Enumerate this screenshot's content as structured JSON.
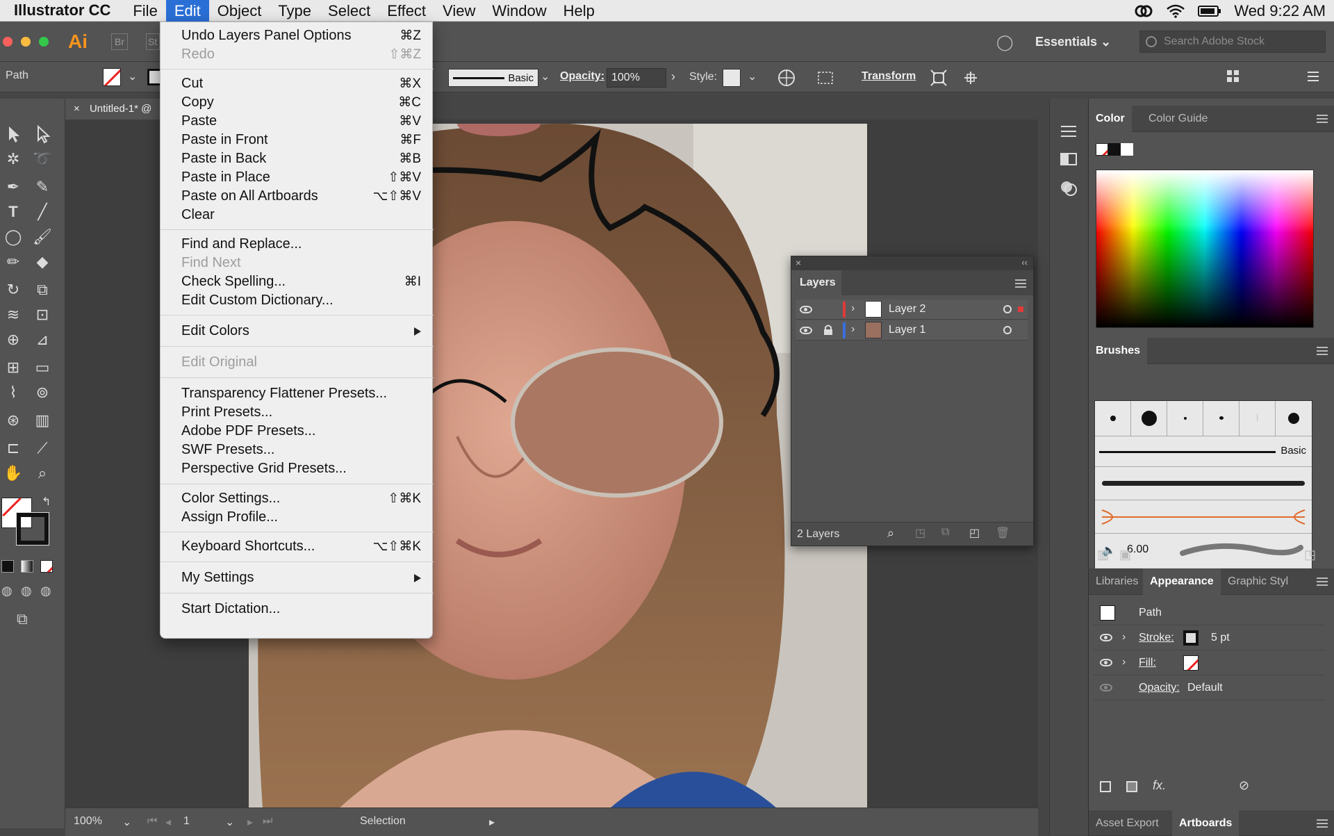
{
  "menubar": {
    "app_name": "Illustrator CC",
    "items": [
      "File",
      "Edit",
      "Object",
      "Type",
      "Select",
      "Effect",
      "View",
      "Window",
      "Help"
    ],
    "clock": "Wed 9:22 AM"
  },
  "appbar": {
    "logo": "Ai",
    "bridge": "Br",
    "stock": "St",
    "workspace": "Essentials",
    "search_placeholder": "Search Adobe Stock"
  },
  "control_bar": {
    "selection_type": "Path",
    "brush_name": "Basic",
    "opacity_label": "Opacity:",
    "opacity_value": "100%",
    "style_label": "Style:",
    "transform_label": "Transform"
  },
  "document": {
    "tab_title": "Untitled-1* @",
    "tab_close": "×"
  },
  "status_bar": {
    "zoom": "100%",
    "artboard_number": "1",
    "tool_name": "Selection"
  },
  "edit_menu": {
    "items": [
      {
        "label": "Undo Layers Panel Options",
        "shortcut": "⌘Z",
        "disabled": false
      },
      {
        "label": "Redo",
        "shortcut": "⇧⌘Z",
        "disabled": true
      },
      {
        "label": "Cut",
        "shortcut": "⌘X",
        "disabled": false
      },
      {
        "label": "Copy",
        "shortcut": "⌘C",
        "disabled": false
      },
      {
        "label": "Paste",
        "shortcut": "⌘V",
        "disabled": false
      },
      {
        "label": "Paste in Front",
        "shortcut": "⌘F",
        "disabled": false
      },
      {
        "label": "Paste in Back",
        "shortcut": "⌘B",
        "disabled": false
      },
      {
        "label": "Paste in Place",
        "shortcut": "⇧⌘V",
        "disabled": false
      },
      {
        "label": "Paste on All Artboards",
        "shortcut": "⌥⇧⌘V",
        "disabled": false
      },
      {
        "label": "Clear",
        "shortcut": "",
        "disabled": false
      },
      {
        "label": "Find and Replace...",
        "shortcut": "",
        "disabled": false
      },
      {
        "label": "Find Next",
        "shortcut": "",
        "disabled": true
      },
      {
        "label": "Check Spelling...",
        "shortcut": "⌘I",
        "disabled": false
      },
      {
        "label": "Edit Custom Dictionary...",
        "shortcut": "",
        "disabled": false
      },
      {
        "label": "Edit Colors",
        "shortcut": "",
        "disabled": false,
        "submenu": true
      },
      {
        "label": "Edit Original",
        "shortcut": "",
        "disabled": true
      },
      {
        "label": "Transparency Flattener Presets...",
        "shortcut": "",
        "disabled": false
      },
      {
        "label": "Print Presets...",
        "shortcut": "",
        "disabled": false
      },
      {
        "label": "Adobe PDF Presets...",
        "shortcut": "",
        "disabled": false
      },
      {
        "label": "SWF Presets...",
        "shortcut": "",
        "disabled": false
      },
      {
        "label": "Perspective Grid Presets...",
        "shortcut": "",
        "disabled": false
      },
      {
        "label": "Color Settings...",
        "shortcut": "⇧⌘K",
        "disabled": false
      },
      {
        "label": "Assign Profile...",
        "shortcut": "",
        "disabled": false
      },
      {
        "label": "Keyboard Shortcuts...",
        "shortcut": "⌥⇧⌘K",
        "disabled": false
      },
      {
        "label": "My Settings",
        "shortcut": "",
        "disabled": false,
        "submenu": true
      },
      {
        "label": "Start Dictation...",
        "shortcut": "",
        "disabled": false
      }
    ]
  },
  "layers_panel": {
    "tab": "Layers",
    "layers": [
      {
        "name": "Layer 2",
        "color": "#e03a3a",
        "locked": false
      },
      {
        "name": "Layer 1",
        "color": "#3a6ee0",
        "locked": true
      }
    ],
    "footer_count": "2 Layers"
  },
  "color_panel": {
    "tabs": [
      "Color",
      "Color Guide"
    ]
  },
  "brushes_panel": {
    "tab": "Brushes",
    "basic_label": "Basic",
    "size_value": "6.00"
  },
  "appearance_panel": {
    "tabs": [
      "Libraries",
      "Appearance",
      "Graphic Styl"
    ],
    "object": "Path",
    "stroke_label": "Stroke:",
    "stroke_value": "5 pt",
    "fill_label": "Fill:",
    "opacity_label": "Opacity:",
    "opacity_value": "Default",
    "fx_label": "fx."
  },
  "bottom_tabs": [
    "Asset Export",
    "Artboards"
  ],
  "colors": {
    "accent": "#2a6fd6",
    "panel": "#535353",
    "menu_bg": "#efefef",
    "ai_orange": "#f7931e"
  }
}
